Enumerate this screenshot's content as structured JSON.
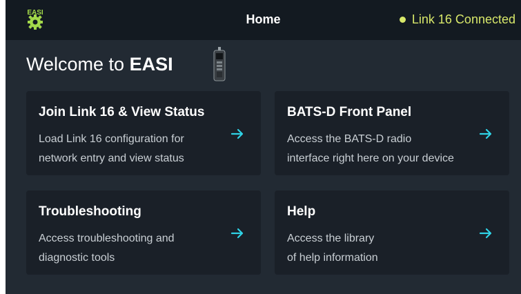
{
  "header": {
    "logo_text": "EASI",
    "title": "Home",
    "status": "Link 16 Connected",
    "status_color": "#d8e86a"
  },
  "welcome": {
    "prefix": "Welcome to ",
    "brand": "EASI"
  },
  "cards": [
    {
      "title": "Join Link 16 & View Status",
      "line1": "Load Link 16 configuration for",
      "line2": "network entry and view status"
    },
    {
      "title": "BATS-D Front Panel",
      "line1": "Access the BATS-D radio",
      "line2": "interface right here on your device"
    },
    {
      "title": "Troubleshooting",
      "line1": "Access troubleshooting and",
      "line2": "diagnostic tools"
    },
    {
      "title": "Help",
      "line1": "Access the library",
      "line2": "of help information"
    }
  ],
  "colors": {
    "background": "#222a33",
    "header": "#131a21",
    "card": "#1a2028",
    "accent_arrow": "#2fd3e6",
    "logo": "#a3d94a"
  },
  "icons": {
    "logo": "easi-gear-logo-icon",
    "device": "handheld-radio-icon",
    "arrow": "arrow-right-icon"
  }
}
